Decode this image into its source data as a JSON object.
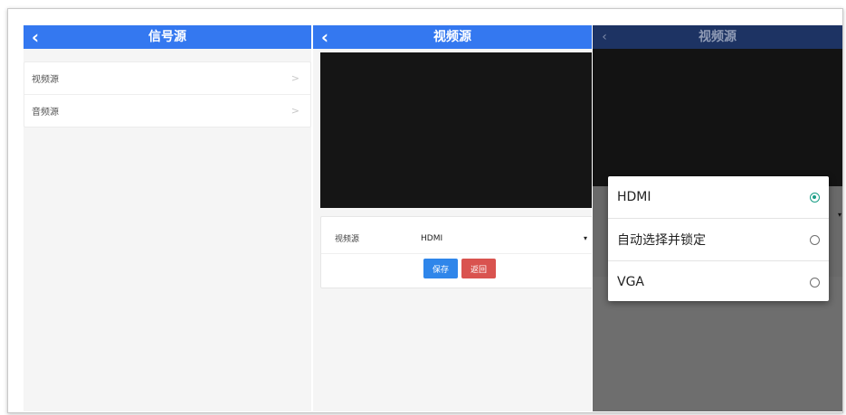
{
  "panel_signal": {
    "title": "信号源",
    "back_icon": "chevron-left-icon",
    "items": [
      {
        "label": "视频源",
        "chevron": ">"
      },
      {
        "label": "音频源",
        "chevron": ">"
      }
    ]
  },
  "panel_video": {
    "title": "视频源",
    "back_icon": "chevron-left-icon",
    "form": {
      "label": "视频源",
      "selected": "HDMI",
      "dropdown_arrow": "▾"
    },
    "buttons": {
      "save": "保存",
      "back": "返回"
    }
  },
  "panel_picker": {
    "title": "视频源",
    "back_icon": "chevron-left-icon",
    "dim_arrow": "▾",
    "options": [
      {
        "label": "HDMI",
        "checked": true
      },
      {
        "label": "自动选择并锁定",
        "checked": false
      },
      {
        "label": "VGA",
        "checked": false
      }
    ]
  },
  "colors": {
    "header_blue": "#3478f0",
    "save_blue": "#2f86ea",
    "back_red": "#d9534f",
    "radio_teal": "#1a9e86"
  }
}
